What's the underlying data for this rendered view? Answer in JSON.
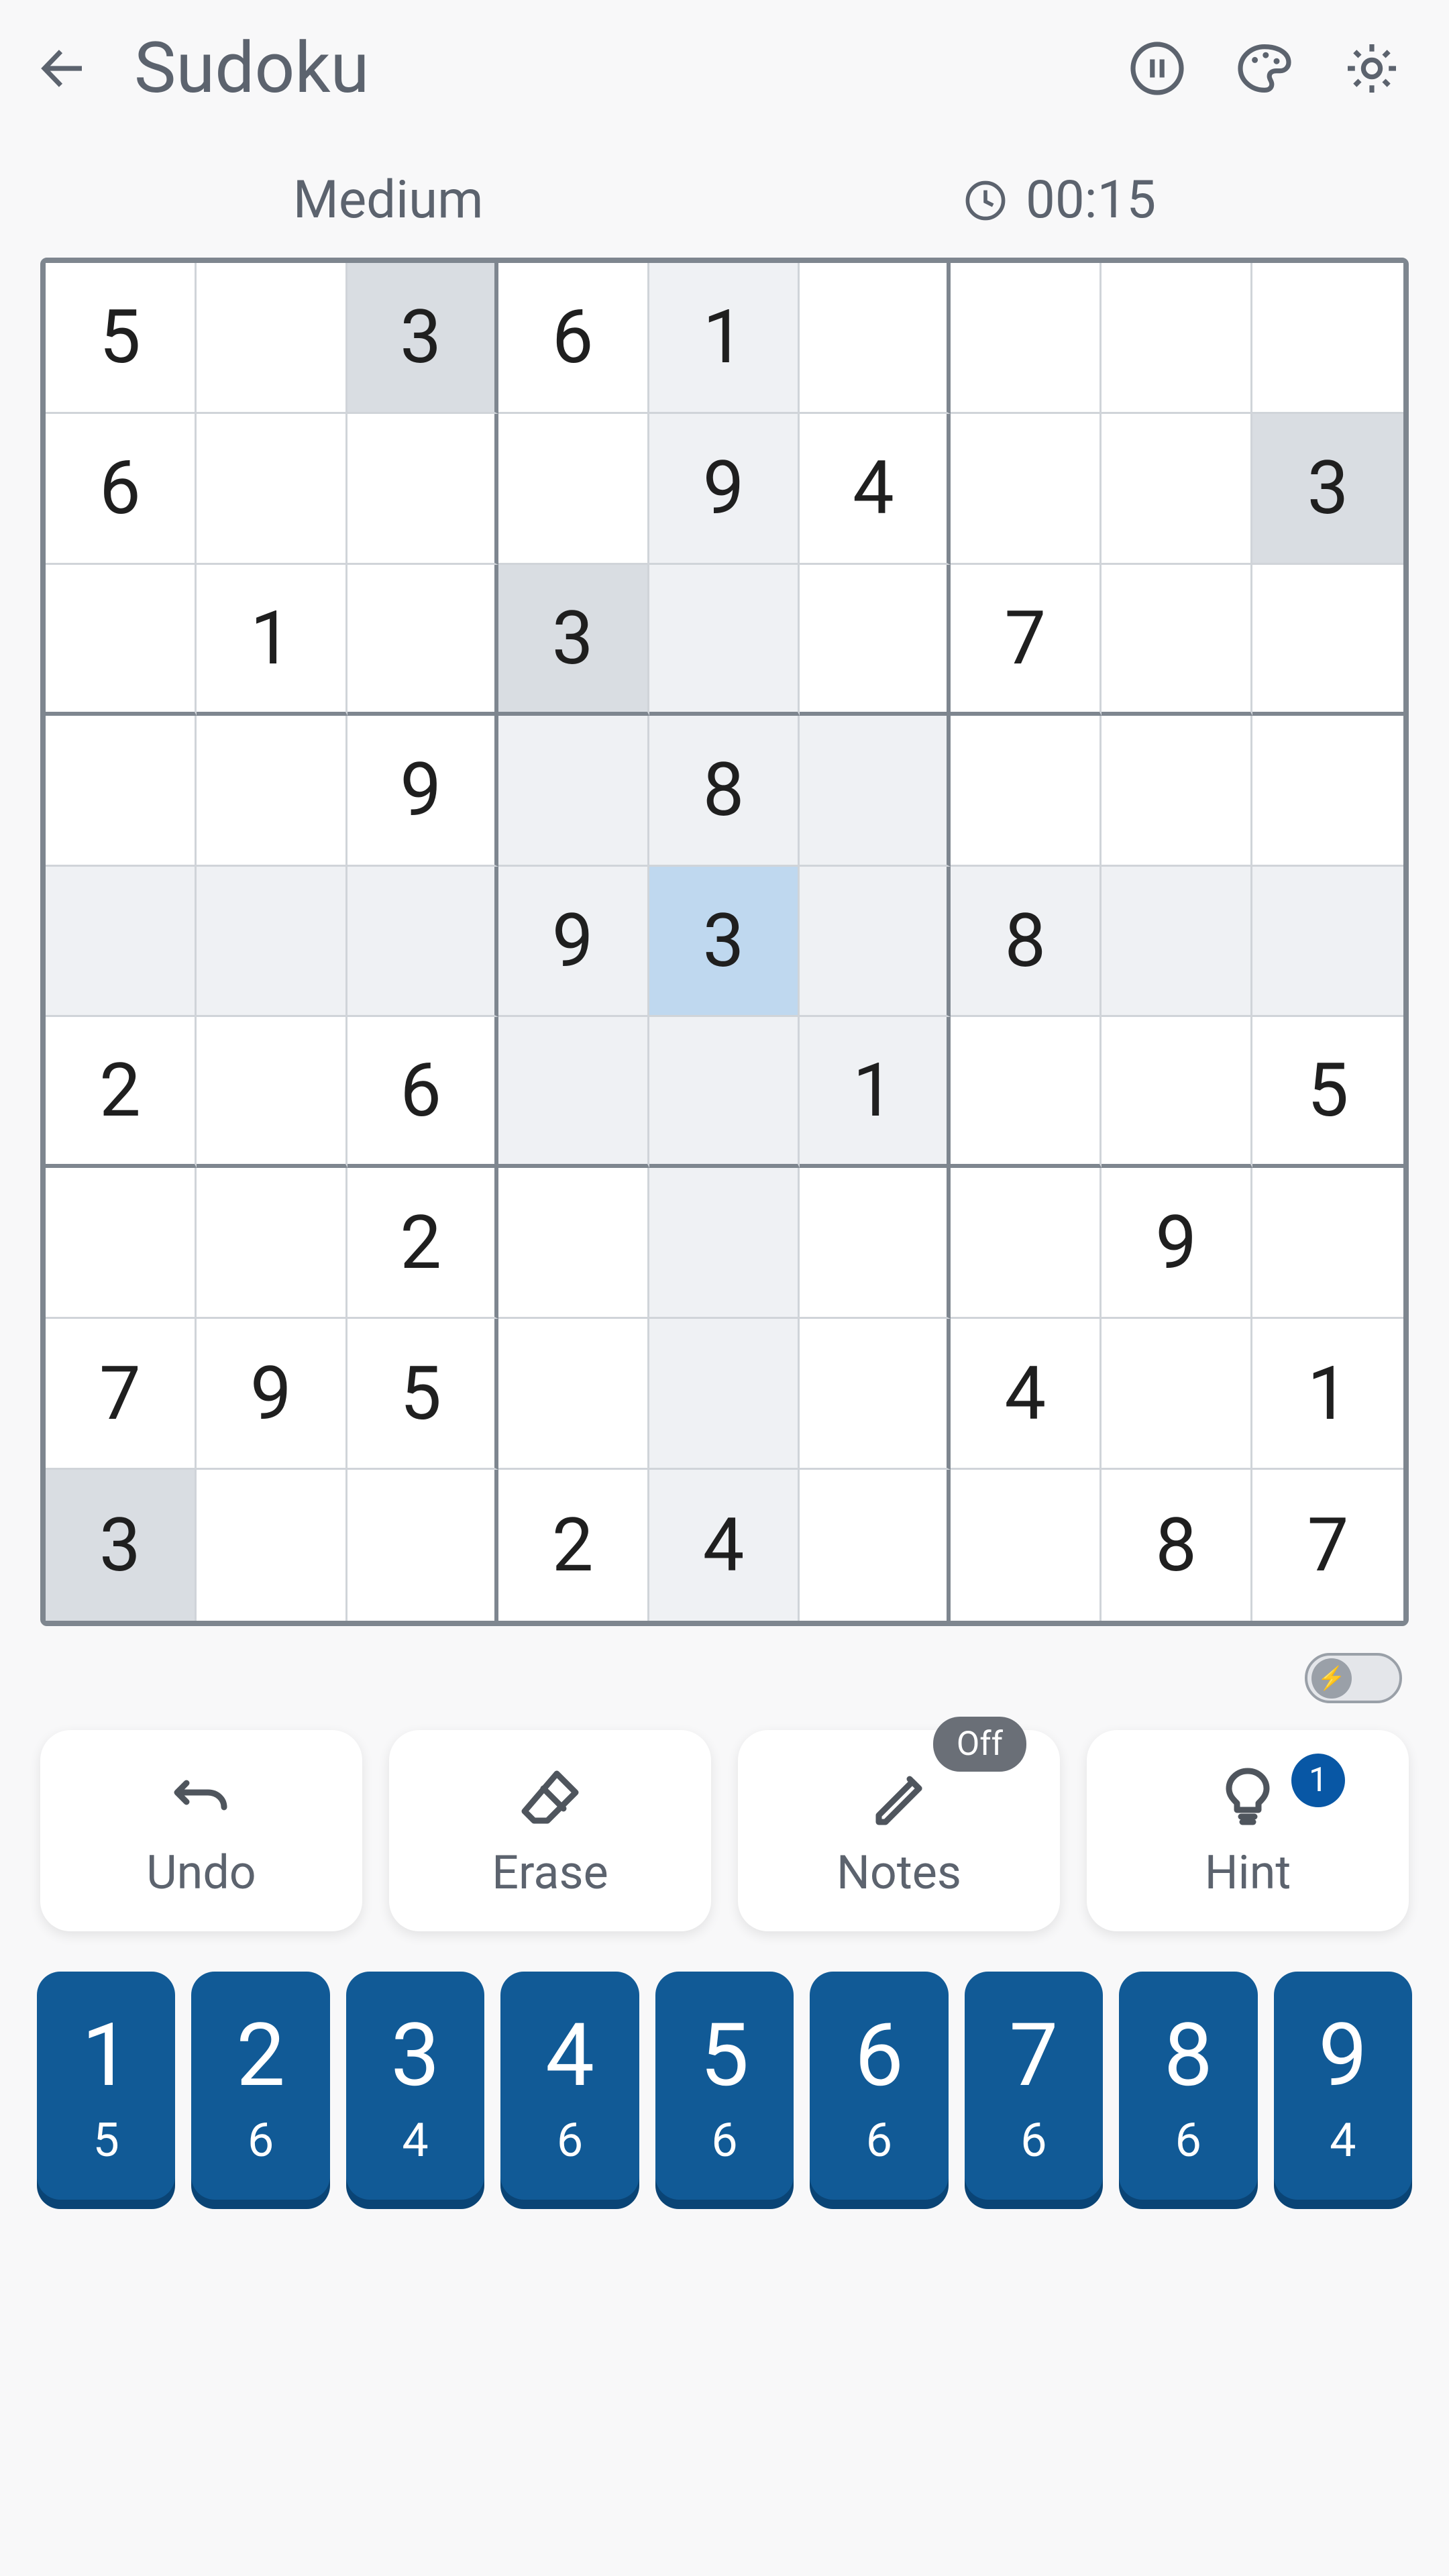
{
  "header": {
    "title": "Sudoku"
  },
  "status": {
    "difficulty": "Medium",
    "time": "00:15"
  },
  "board": {
    "selected": [
      4,
      4
    ],
    "cells": [
      [
        "5",
        "",
        "3",
        "6",
        "1",
        "",
        "",
        "",
        ""
      ],
      [
        "6",
        "",
        "",
        "",
        "9",
        "4",
        "",
        "",
        "3"
      ],
      [
        "",
        "1",
        "",
        "3",
        "",
        "",
        "7",
        "",
        ""
      ],
      [
        "",
        "",
        "9",
        "",
        "8",
        "",
        "",
        "",
        ""
      ],
      [
        "",
        "",
        "",
        "9",
        "3",
        "",
        "8",
        "",
        ""
      ],
      [
        "2",
        "",
        "6",
        "",
        "",
        "1",
        "",
        "",
        "5"
      ],
      [
        "",
        "",
        "2",
        "",
        "",
        "",
        "",
        "9",
        ""
      ],
      [
        "7",
        "9",
        "5",
        "",
        "",
        "",
        "4",
        "",
        "1"
      ],
      [
        "3",
        "",
        "",
        "2",
        "4",
        "",
        "",
        "8",
        "7"
      ]
    ]
  },
  "tools": {
    "undo": "Undo",
    "erase": "Erase",
    "notes": "Notes",
    "notes_state": "Off",
    "hint": "Hint",
    "hint_count": "1"
  },
  "keypad": [
    {
      "digit": "1",
      "remaining": "5"
    },
    {
      "digit": "2",
      "remaining": "6"
    },
    {
      "digit": "3",
      "remaining": "4"
    },
    {
      "digit": "4",
      "remaining": "6"
    },
    {
      "digit": "5",
      "remaining": "6"
    },
    {
      "digit": "6",
      "remaining": "6"
    },
    {
      "digit": "7",
      "remaining": "6"
    },
    {
      "digit": "8",
      "remaining": "6"
    },
    {
      "digit": "9",
      "remaining": "4"
    }
  ]
}
